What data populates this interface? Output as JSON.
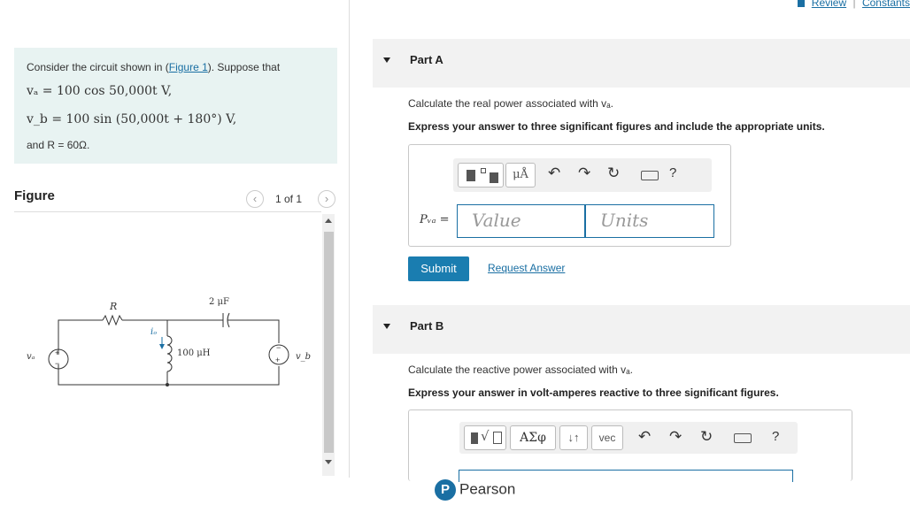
{
  "header": {
    "review": "Review",
    "separator": "|",
    "constants": "Constants"
  },
  "problem": {
    "intro_prefix": "Consider the circuit shown in (",
    "figure_link": "Figure 1",
    "intro_suffix": "). Suppose that",
    "va_eq": "vₐ = 100 cos 50,000t V,",
    "vb_eq": "v_b = 100 sin (50,000t + 180°) V,",
    "and_r": "and R = 60Ω."
  },
  "figure": {
    "title": "Figure",
    "pager": "1 of 1",
    "labels": {
      "R": "R",
      "cap": "2 μF",
      "ind": "100 μH",
      "io": "iₒ",
      "va": "vₐ",
      "vb": "v_b",
      "plus": "+",
      "minus": "−"
    }
  },
  "partA": {
    "label": "Part A",
    "question": "Calculate the real power associated with vₐ.",
    "instruction": "Express your answer to three significant figures and include the appropriate units.",
    "toolbar": {
      "units": "μÅ",
      "help": "?"
    },
    "var_label": "Pᵥₐ =",
    "value_placeholder": "Value",
    "units_placeholder": "Units",
    "submit": "Submit",
    "request_answer": "Request Answer"
  },
  "partB": {
    "label": "Part B",
    "question": "Calculate the reactive power associated with vₐ.",
    "instruction": "Express your answer in volt-amperes reactive to three significant figures.",
    "toolbar": {
      "greek": "ΑΣφ",
      "arrows": "↓↑",
      "vec": "vec",
      "help": "?"
    }
  },
  "footer": {
    "brand": "Pearson",
    "logo_letter": "P"
  },
  "colors": {
    "accent": "#1a7db0",
    "problem_bg": "#e8f3f2",
    "link": "#1a6fa3"
  }
}
